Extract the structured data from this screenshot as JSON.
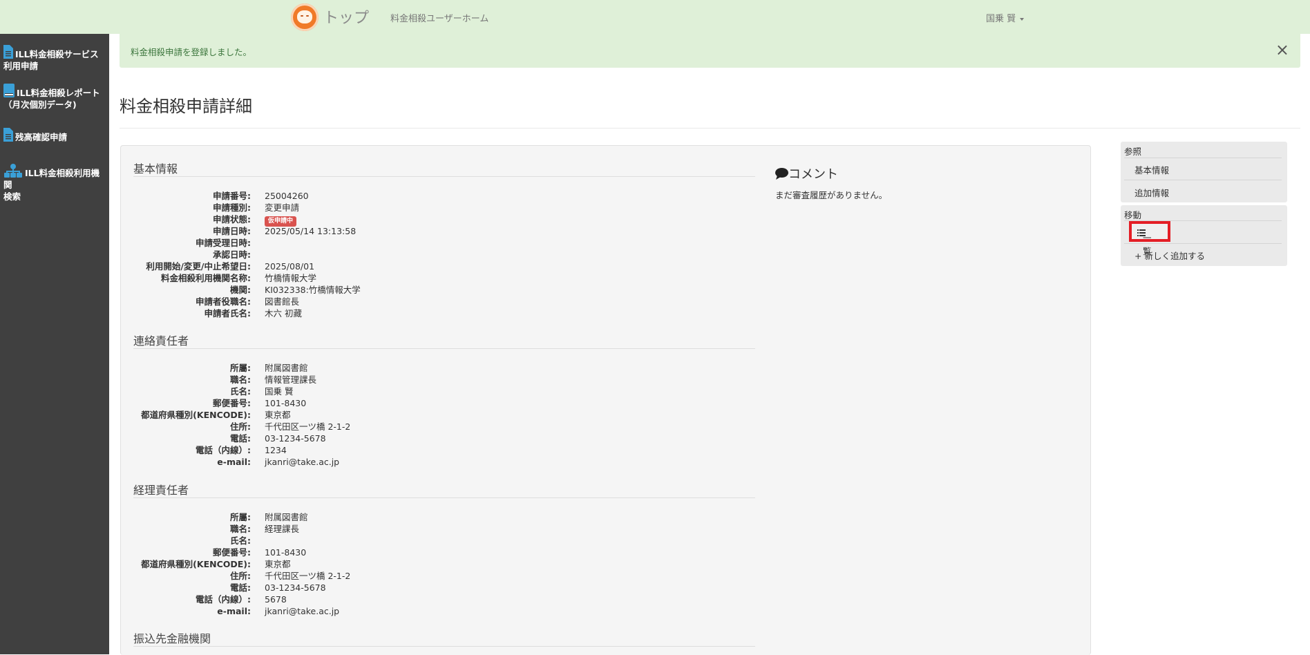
{
  "header": {
    "brand": "トップ",
    "home_link": "料金相殺ユーザーホーム",
    "user": "国乗 賢"
  },
  "sidebar": {
    "items": [
      {
        "label_1": "ILL料金相殺サービス",
        "label_2": "利用申請",
        "icon": "document-icon"
      },
      {
        "label_1": "ILL料金相殺レポート",
        "label_2": "（月次個別データ)",
        "icon": "book-icon"
      },
      {
        "label_1": "残高確認申請",
        "icon": "document-icon"
      },
      {
        "label_1": "ILL料金相殺利用機関",
        "label_2": "検索",
        "icon": "sitemap-icon"
      }
    ]
  },
  "alert": {
    "message": "料金相殺申請を登録しました。",
    "close": "×"
  },
  "page_title": "料金相殺申請詳細",
  "basic": {
    "heading": "基本情報",
    "rows": [
      {
        "label": "申請番号:",
        "value": "25004260"
      },
      {
        "label": "申請種別:",
        "value": "変更申請"
      },
      {
        "label": "申請状態:",
        "value": "仮申請中"
      },
      {
        "label": "申請日時:",
        "value": "2025/05/14 13:13:58"
      },
      {
        "label": "申請受理日時:",
        "value": ""
      },
      {
        "label": "承認日時:",
        "value": ""
      },
      {
        "label": "利用開始/変更/中止希望日:",
        "value": "2025/08/01"
      },
      {
        "label": "料金相殺利用機関名称:",
        "value": "竹橋情報大学"
      },
      {
        "label": "機関:",
        "value": "KI032338:竹橋情報大学"
      },
      {
        "label": "申請者役職名:",
        "value": "図書館長"
      },
      {
        "label": "申請者氏名:",
        "value": "木六 初藏"
      }
    ]
  },
  "contact": {
    "heading": "連絡責任者",
    "rows": [
      {
        "label": "所屬:",
        "value": "附属図書館"
      },
      {
        "label": "職名:",
        "value": "情報管理課長"
      },
      {
        "label": "氏名:",
        "value": "国乗 賢"
      },
      {
        "label": "郵便番号:",
        "value": "101-8430"
      },
      {
        "label": "都道府県種別(KENCODE):",
        "value": "東京都"
      },
      {
        "label": "住所:",
        "value": "千代田区一ツ橋 2-1-2"
      },
      {
        "label": "電話:",
        "value": "03-1234-5678"
      },
      {
        "label": "電話（内線）:",
        "value": "1234"
      },
      {
        "label": "e-mail:",
        "value": "jkanri@take.ac.jp"
      }
    ]
  },
  "accounting": {
    "heading": "経理責任者",
    "rows": [
      {
        "label": "所屬:",
        "value": "附属図書館"
      },
      {
        "label": "職名:",
        "value": "経理課長"
      },
      {
        "label": "氏名:",
        "value": ""
      },
      {
        "label": "郵便番号:",
        "value": "101-8430"
      },
      {
        "label": "都道府県種別(KENCODE):",
        "value": "東京都"
      },
      {
        "label": "住所:",
        "value": "千代田区一ツ橋 2-1-2"
      },
      {
        "label": "電話:",
        "value": "03-1234-5678"
      },
      {
        "label": "電話（内線）:",
        "value": "5678"
      },
      {
        "label": "e-mail:",
        "value": "jkanri@take.ac.jp"
      }
    ]
  },
  "bank": {
    "heading": "振込先金融機関"
  },
  "comment": {
    "heading": "コメント",
    "text": "まだ審査履歴がありません。"
  },
  "right_nav": {
    "ref_heading": "参照",
    "ref_items": [
      "基本情報",
      "追加情報"
    ],
    "move_heading": "移動",
    "list_label": "一覧",
    "add_label": "新しく追加する"
  },
  "colors": {
    "header_bg": "#dff0d8",
    "sidebar_bg": "#404040",
    "badge": "#d9534f",
    "highlight": "#e41e26",
    "icon_blue": "#3aa0d8"
  }
}
